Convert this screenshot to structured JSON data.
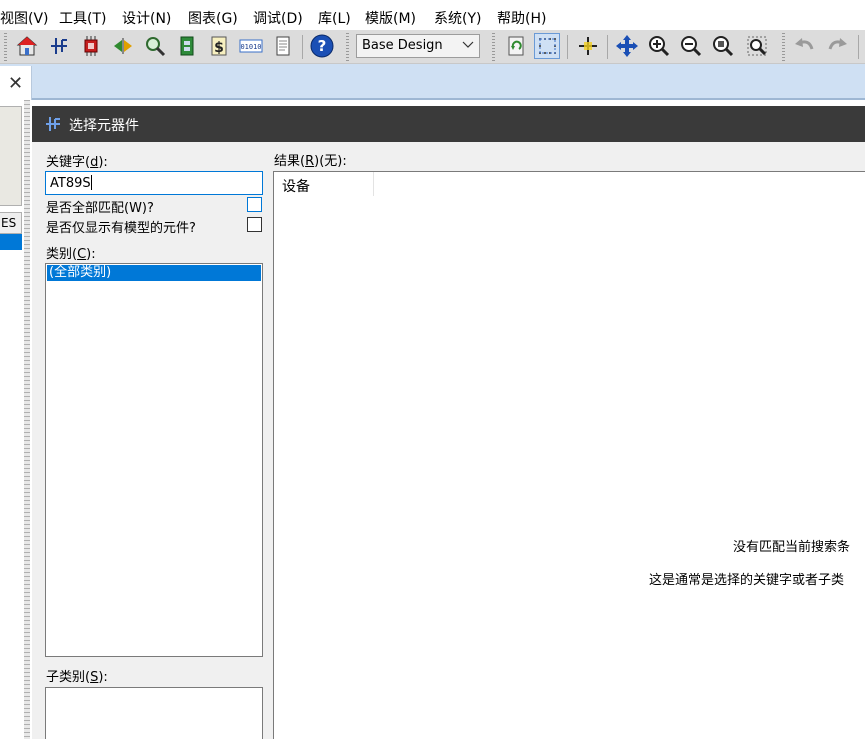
{
  "menu": [
    "视图(V)",
    "工具(T)",
    "设计(N)",
    "图表(G)",
    "调试(D)",
    "库(L)",
    "模版(M)",
    "系统(Y)",
    "帮助(H)"
  ],
  "toolbar": {
    "design_combo": "Base Design",
    "buttons": [
      "home-icon",
      "schematic-icon",
      "chip-icon",
      "signal-icon",
      "zoom-search-icon",
      "pcb-icon",
      "dollar-icon",
      "binary-icon",
      "document-icon",
      "help-icon",
      "refresh-icon",
      "grid-icon",
      "crosshair-icon",
      "move-icon",
      "zoom-in-icon",
      "zoom-out-icon",
      "zoom-fit-icon",
      "zoom-area-icon",
      "undo-icon",
      "redo-icon"
    ]
  },
  "tab": {
    "close_glyph": "✕"
  },
  "left_panel": {
    "tab_label": "ES"
  },
  "dialog": {
    "title": "选择元器件",
    "keyword_label": "关键字",
    "keyword_hotkey": "d",
    "keyword_value": "AT89S",
    "match_all_label": "是否全部匹配(W)?",
    "only_models_label": "是否仅显示有模型的元件?",
    "category_label": "类别",
    "category_hotkey": "C",
    "categories": [
      "(全部类别)"
    ],
    "subcategory_label": "子类别",
    "subcategory_hotkey": "S",
    "results_label": "结果",
    "results_hotkey": "R",
    "results_count": "(无):",
    "results_column": "设备",
    "empty_message_1": "没有匹配当前搜索条",
    "empty_message_2": "这是通常是选择的关键字或者子类"
  },
  "colors": {
    "accent": "#0078d7",
    "title_bar": "#3a3a3a",
    "tab_strip": "#cfe0f3",
    "dialog_bg": "#f0f0f0"
  }
}
